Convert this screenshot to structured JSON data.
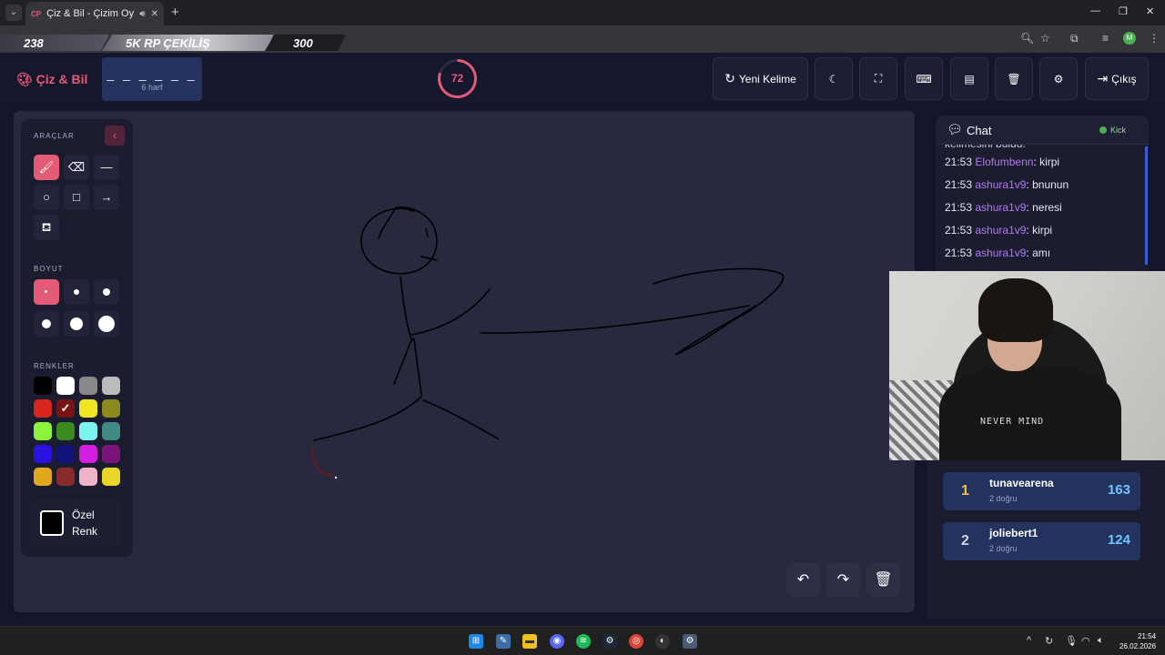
{
  "browser": {
    "tab_title": "Çiz & Bil - Çizim Oyunu",
    "tab_favicon": "CP",
    "profile_initial": "M"
  },
  "overlay": {
    "left_value": "238",
    "banner_text": "5K RP ÇEKİLİŞ",
    "right_value": "300"
  },
  "header": {
    "brand": "Çiz & Bil",
    "word_dashes": "_ _ _ _ _ _",
    "word_hint": "6 harf",
    "timer_value": "72",
    "timer_fraction": 0.8,
    "new_word_label": "Yeni Kelime",
    "logout_label": "Çıkış",
    "accent_color": "#e45b77"
  },
  "tools": {
    "tools_label": "ARAÇLAR",
    "size_label": "BOYUT",
    "colors_label": "RENKLER",
    "custom_color_label": "Özel Renk",
    "colors": [
      "#000000",
      "#ffffff",
      "#888888",
      "#bbbbbb",
      "#d9261c",
      "#7a1414",
      "#f0e626",
      "#8a8a1e",
      "#8ef23a",
      "#3a8a1e",
      "#7ef2ee",
      "#3f8a85",
      "#2a12e0",
      "#12127a",
      "#d41ee0",
      "#7a137a",
      "#e0a81e",
      "#8a2a2a",
      "#f0b4c8",
      "#e8d62a"
    ],
    "selected_color_index": 5
  },
  "chat": {
    "title": "Chat",
    "source": "Kick",
    "partial_line": "kelimesini buldu!",
    "messages": [
      {
        "time": "21:53",
        "user": "Elofumbenn",
        "text": ": kirpi"
      },
      {
        "time": "21:53",
        "user": "ashura1v9",
        "text": ": bnunun"
      },
      {
        "time": "21:53",
        "user": "ashura1v9",
        "text": ": neresi"
      },
      {
        "time": "21:53",
        "user": "ashura1v9",
        "text": ": kirpi"
      },
      {
        "time": "21:53",
        "user": "ashura1v9",
        "text": ": amı"
      }
    ]
  },
  "webcam": {
    "shirt_text": "NEVER MIND"
  },
  "leaderboard": [
    {
      "rank": "1",
      "name": "tunavearena",
      "sub": "2 doğru",
      "score": "163",
      "rank_color": "#f2c230"
    },
    {
      "rank": "2",
      "name": "joliebert1",
      "sub": "2 doğru",
      "score": "124",
      "rank_color": "#cfd3e0"
    }
  ],
  "taskbar": {
    "time": "21:54",
    "date": "26.02.2026"
  }
}
